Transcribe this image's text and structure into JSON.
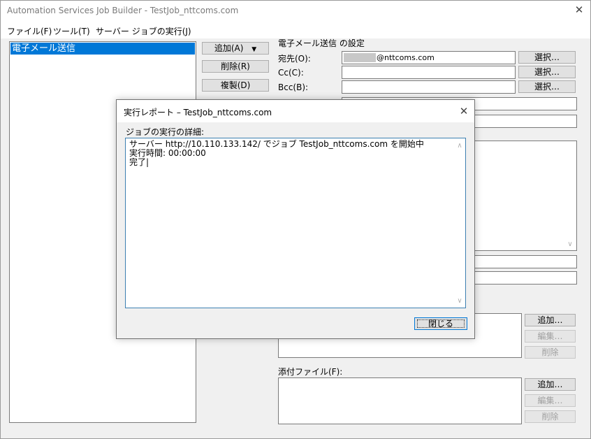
{
  "window": {
    "title": "Automation Services Job Builder - TestJob_nttcoms.com",
    "close": "✕"
  },
  "menu": {
    "items": [
      "ファイル(F)",
      "ツール(T)",
      "サーバー ジョブの実行(J)"
    ]
  },
  "job_list": {
    "items": [
      "電子メール送信"
    ]
  },
  "action_buttons": {
    "add": "追加(A)",
    "add_arrow": "▼",
    "delete": "削除(R)",
    "duplicate": "複製(D)"
  },
  "settings": {
    "group_title": "電子メール送信 の設定",
    "to_label": "宛先(O):",
    "to_value": "@nttcoms.com",
    "cc_label": "Cc(C):",
    "bcc_label": "Bcc(B):",
    "select": "選択…"
  },
  "side_buttons": {
    "add": "追加…",
    "edit": "編集…",
    "delete": "削除"
  },
  "attachments": {
    "label": "添付ファイル(F):"
  },
  "dialog": {
    "title": "実行レポート – TestJob_nttcoms.com",
    "close": "✕",
    "details_label": "ジョブの実行の詳細:",
    "lines": [
      "サーバー http://10.110.133.142/ でジョブ TestJob_nttcoms.com を開始中",
      "実行時間: 00:00:00",
      "完了|"
    ],
    "scroll_up": "∧",
    "scroll_down": "∨",
    "close_button": "閉じる"
  },
  "body_scroll_down": "∨",
  "colors": {
    "selection": "#0078d7",
    "focus_border": "#3c7fb1"
  }
}
